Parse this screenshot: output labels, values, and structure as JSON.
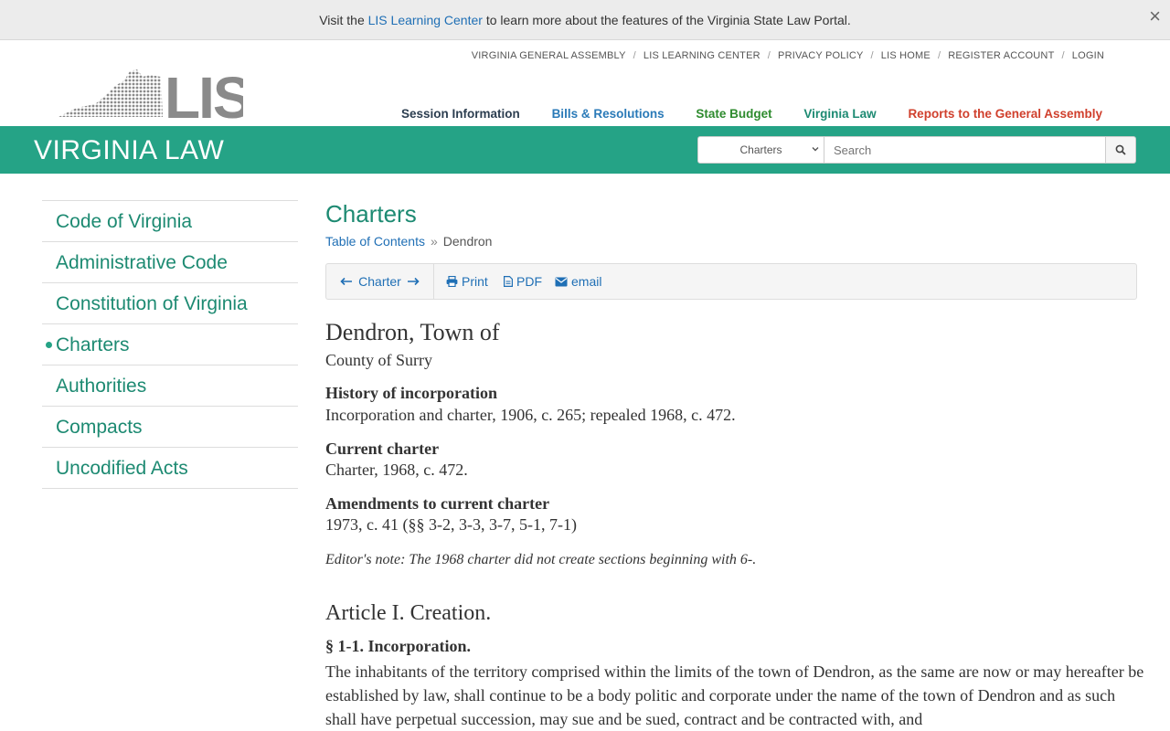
{
  "banner": {
    "prefix": "Visit the",
    "link": "LIS Learning Center",
    "suffix": "to learn more about the features of the Virginia State Law Portal.",
    "close": "×"
  },
  "utility_nav": [
    "VIRGINIA GENERAL ASSEMBLY",
    "LIS LEARNING CENTER",
    "PRIVACY POLICY",
    "LIS HOME",
    "REGISTER ACCOUNT",
    "LOGIN"
  ],
  "utility_sep": "/",
  "main_nav": {
    "session": "Session Information",
    "bills": "Bills & Resolutions",
    "budget": "State Budget",
    "law": "Virginia Law",
    "reports": "Reports to the General Assembly"
  },
  "logo": {
    "text": "LIS"
  },
  "greenbar": {
    "title": "VIRGINIA LAW"
  },
  "search": {
    "select_value": "Charters",
    "placeholder": "Search"
  },
  "sidebar": {
    "items": [
      {
        "label": "Code of Virginia"
      },
      {
        "label": "Administrative Code"
      },
      {
        "label": "Constitution of Virginia"
      },
      {
        "label": "Charters"
      },
      {
        "label": "Authorities"
      },
      {
        "label": "Compacts"
      },
      {
        "label": "Uncodified Acts"
      }
    ]
  },
  "main": {
    "title": "Charters",
    "breadcrumb": {
      "link": "Table of Contents",
      "sep": "»",
      "current": "Dendron"
    },
    "toolbar": {
      "charter": "Charter",
      "print": "Print",
      "pdf": "PDF",
      "email": "email"
    },
    "doc_title": "Dendron, Town of",
    "doc_sub": "County of Surry",
    "history_h": "History of incorporation",
    "history_t": "Incorporation and charter, 1906, c. 265; repealed 1968, c. 472.",
    "current_h": "Current charter",
    "current_t": "Charter, 1968, c. 472.",
    "amend_h": "Amendments to current charter",
    "amend_t": "1973, c. 41 (§§ 3-2, 3-3, 3-7, 5-1, 7-1)",
    "editor": "Editor's note: The 1968 charter did not create sections beginning with 6-.",
    "article": "Article I. Creation.",
    "section_h": "§ 1-1. Incorporation.",
    "body": "The inhabitants of the territory comprised within the limits of the town of Dendron, as the same are now or may hereafter be established by law, shall continue to be a body politic and corporate under the name of the town of Dendron and as such shall have perpetual succession, may sue and be sued, contract and be contracted with, and"
  },
  "colors": {
    "brand_green": "#25a386",
    "link_blue": "#1f6fb5",
    "heading_green": "#1d8a72",
    "reports_red": "#d0402d"
  }
}
